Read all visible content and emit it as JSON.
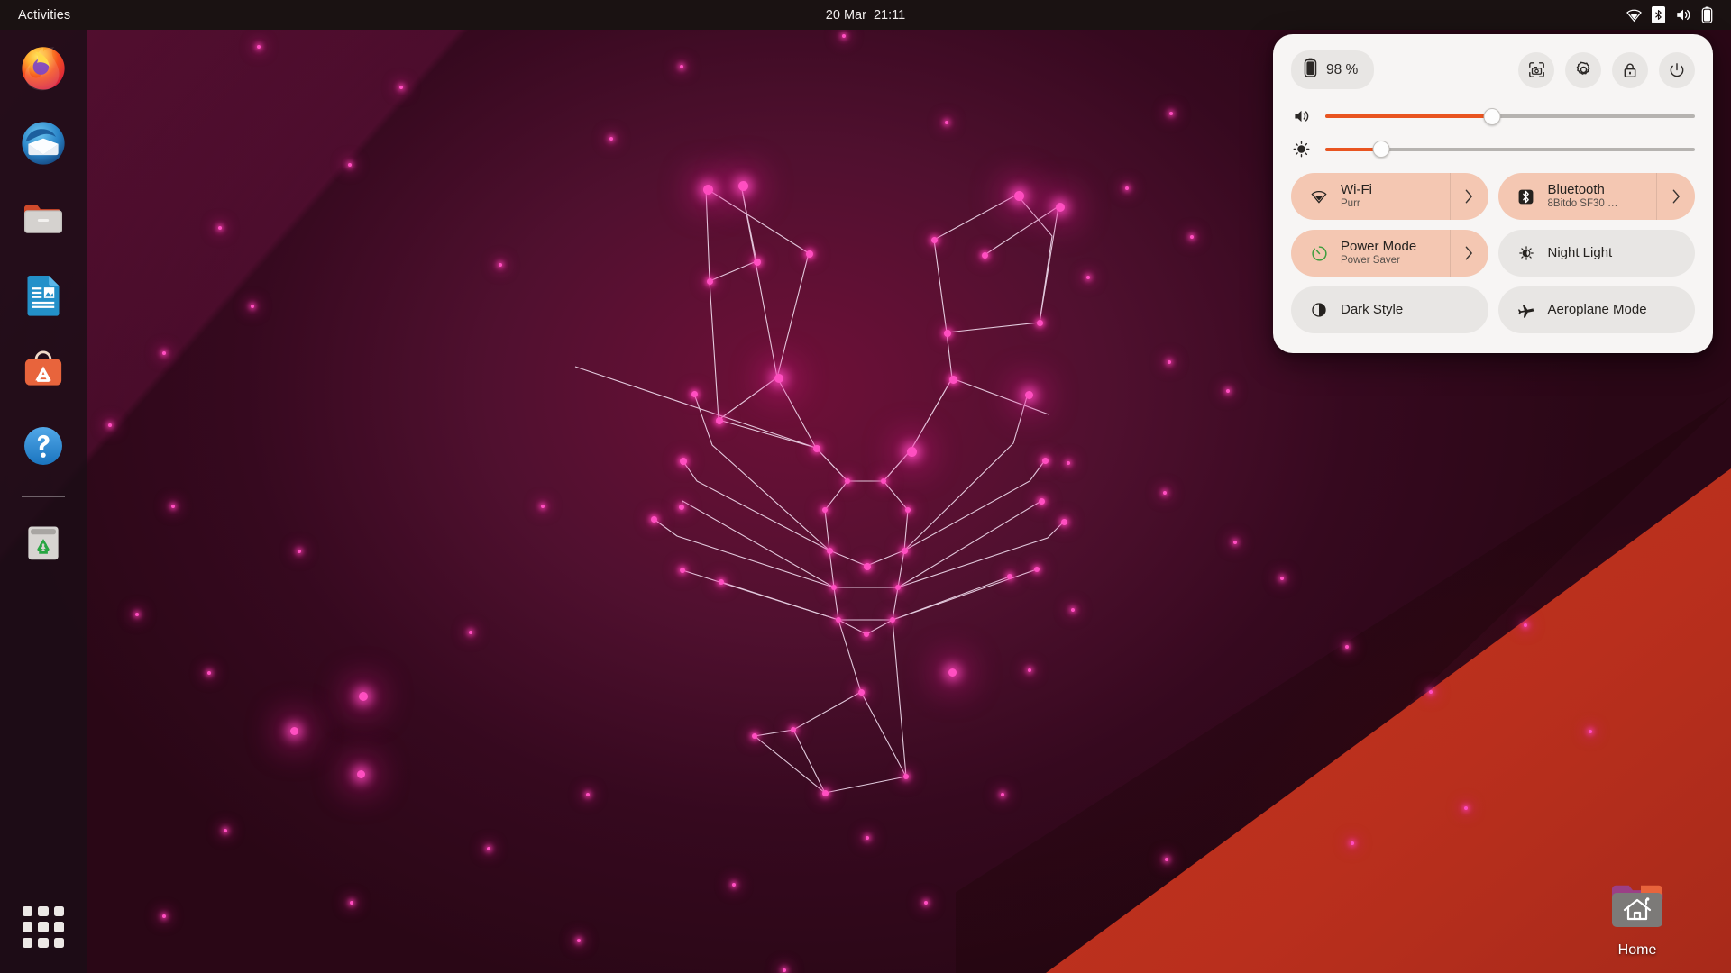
{
  "topbar": {
    "activities_label": "Activities",
    "clock": "20 Mar  21:11",
    "status_icons": [
      "wifi-icon",
      "bluetooth-icon",
      "volume-icon",
      "battery-icon"
    ]
  },
  "dock": {
    "items": [
      {
        "name": "firefox",
        "label": "Firefox"
      },
      {
        "name": "thunderbird",
        "label": "Thunderbird Mail"
      },
      {
        "name": "files",
        "label": "Files"
      },
      {
        "name": "libreoffice-writer",
        "label": "LibreOffice Writer"
      },
      {
        "name": "ubuntu-software",
        "label": "Ubuntu Software"
      },
      {
        "name": "help",
        "label": "Help"
      },
      {
        "name": "trash",
        "label": "Trash"
      }
    ],
    "show_apps_label": "Show Applications"
  },
  "desktop": {
    "icons": [
      {
        "name": "home-folder",
        "label": "Home"
      }
    ]
  },
  "quick_settings": {
    "battery": {
      "icon": "battery-icon",
      "percent_label": "98 %"
    },
    "buttons": [
      {
        "name": "screenshot-button",
        "icon": "screenshot-icon",
        "label": "Take Screenshot"
      },
      {
        "name": "settings-button",
        "icon": "gear-icon",
        "label": "Settings"
      },
      {
        "name": "lock-button",
        "icon": "lock-icon",
        "label": "Lock Screen"
      },
      {
        "name": "power-button",
        "icon": "power-icon",
        "label": "Power Off / Log Out"
      }
    ],
    "sliders": [
      {
        "name": "volume-slider",
        "icon": "volume-icon",
        "value": 45,
        "label": "Volume"
      },
      {
        "name": "brightness-slider",
        "icon": "brightness-icon",
        "value": 15,
        "label": "Brightness"
      }
    ],
    "tiles": [
      {
        "name": "wifi-tile",
        "icon": "wifi-icon",
        "title": "Wi-Fi",
        "subtitle": "Purr",
        "active": true,
        "has_arrow": true
      },
      {
        "name": "bluetooth-tile",
        "icon": "bluetooth-icon",
        "title": "Bluetooth",
        "subtitle": "8Bitdo SF30 …",
        "active": true,
        "has_arrow": true
      },
      {
        "name": "power-mode-tile",
        "icon": "power-mode-icon",
        "title": "Power Mode",
        "subtitle": "Power Saver",
        "active": true,
        "has_arrow": true
      },
      {
        "name": "night-light-tile",
        "icon": "night-light-icon",
        "title": "Night Light",
        "subtitle": "",
        "active": false,
        "has_arrow": false
      },
      {
        "name": "dark-style-tile",
        "icon": "dark-style-icon",
        "title": "Dark Style",
        "subtitle": "",
        "active": false,
        "has_arrow": false
      },
      {
        "name": "aeroplane-mode-tile",
        "icon": "aeroplane-icon",
        "title": "Aeroplane Mode",
        "subtitle": "",
        "active": false,
        "has_arrow": false
      }
    ]
  },
  "colors": {
    "accent": "#E95420",
    "panel_bg": "#F7F5F4",
    "tile_active_bg": "#F4C7B2",
    "tile_inactive_bg": "#E8E6E4",
    "topbar_bg": "#1A1212",
    "wallpaper_magenta": "#FF4FC1",
    "wallpaper_red": "#C5341F"
  },
  "wallpaper": {
    "name": "lunar-lobster-constellation"
  }
}
